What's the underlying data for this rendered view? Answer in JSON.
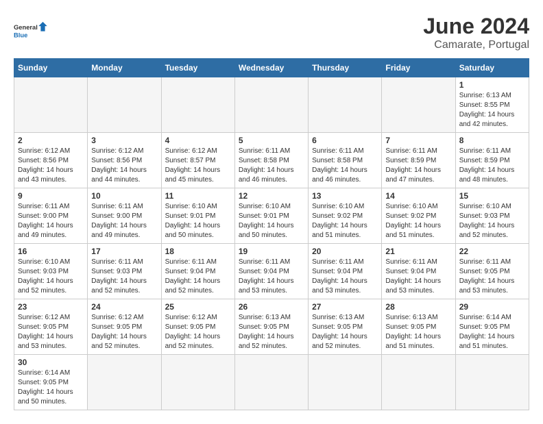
{
  "header": {
    "logo_general": "General",
    "logo_blue": "Blue",
    "month": "June 2024",
    "location": "Camarate, Portugal"
  },
  "days_of_week": [
    "Sunday",
    "Monday",
    "Tuesday",
    "Wednesday",
    "Thursday",
    "Friday",
    "Saturday"
  ],
  "weeks": [
    [
      {
        "day": "",
        "info": ""
      },
      {
        "day": "",
        "info": ""
      },
      {
        "day": "",
        "info": ""
      },
      {
        "day": "",
        "info": ""
      },
      {
        "day": "",
        "info": ""
      },
      {
        "day": "",
        "info": ""
      },
      {
        "day": "1",
        "info": "Sunrise: 6:13 AM\nSunset: 8:55 PM\nDaylight: 14 hours and 42 minutes."
      }
    ],
    [
      {
        "day": "2",
        "info": "Sunrise: 6:12 AM\nSunset: 8:56 PM\nDaylight: 14 hours and 43 minutes."
      },
      {
        "day": "3",
        "info": "Sunrise: 6:12 AM\nSunset: 8:56 PM\nDaylight: 14 hours and 44 minutes."
      },
      {
        "day": "4",
        "info": "Sunrise: 6:12 AM\nSunset: 8:57 PM\nDaylight: 14 hours and 45 minutes."
      },
      {
        "day": "5",
        "info": "Sunrise: 6:11 AM\nSunset: 8:58 PM\nDaylight: 14 hours and 46 minutes."
      },
      {
        "day": "6",
        "info": "Sunrise: 6:11 AM\nSunset: 8:58 PM\nDaylight: 14 hours and 46 minutes."
      },
      {
        "day": "7",
        "info": "Sunrise: 6:11 AM\nSunset: 8:59 PM\nDaylight: 14 hours and 47 minutes."
      },
      {
        "day": "8",
        "info": "Sunrise: 6:11 AM\nSunset: 8:59 PM\nDaylight: 14 hours and 48 minutes."
      }
    ],
    [
      {
        "day": "9",
        "info": "Sunrise: 6:11 AM\nSunset: 9:00 PM\nDaylight: 14 hours and 49 minutes."
      },
      {
        "day": "10",
        "info": "Sunrise: 6:11 AM\nSunset: 9:00 PM\nDaylight: 14 hours and 49 minutes."
      },
      {
        "day": "11",
        "info": "Sunrise: 6:10 AM\nSunset: 9:01 PM\nDaylight: 14 hours and 50 minutes."
      },
      {
        "day": "12",
        "info": "Sunrise: 6:10 AM\nSunset: 9:01 PM\nDaylight: 14 hours and 50 minutes."
      },
      {
        "day": "13",
        "info": "Sunrise: 6:10 AM\nSunset: 9:02 PM\nDaylight: 14 hours and 51 minutes."
      },
      {
        "day": "14",
        "info": "Sunrise: 6:10 AM\nSunset: 9:02 PM\nDaylight: 14 hours and 51 minutes."
      },
      {
        "day": "15",
        "info": "Sunrise: 6:10 AM\nSunset: 9:03 PM\nDaylight: 14 hours and 52 minutes."
      }
    ],
    [
      {
        "day": "16",
        "info": "Sunrise: 6:10 AM\nSunset: 9:03 PM\nDaylight: 14 hours and 52 minutes."
      },
      {
        "day": "17",
        "info": "Sunrise: 6:11 AM\nSunset: 9:03 PM\nDaylight: 14 hours and 52 minutes."
      },
      {
        "day": "18",
        "info": "Sunrise: 6:11 AM\nSunset: 9:04 PM\nDaylight: 14 hours and 52 minutes."
      },
      {
        "day": "19",
        "info": "Sunrise: 6:11 AM\nSunset: 9:04 PM\nDaylight: 14 hours and 53 minutes."
      },
      {
        "day": "20",
        "info": "Sunrise: 6:11 AM\nSunset: 9:04 PM\nDaylight: 14 hours and 53 minutes."
      },
      {
        "day": "21",
        "info": "Sunrise: 6:11 AM\nSunset: 9:04 PM\nDaylight: 14 hours and 53 minutes."
      },
      {
        "day": "22",
        "info": "Sunrise: 6:11 AM\nSunset: 9:05 PM\nDaylight: 14 hours and 53 minutes."
      }
    ],
    [
      {
        "day": "23",
        "info": "Sunrise: 6:12 AM\nSunset: 9:05 PM\nDaylight: 14 hours and 53 minutes."
      },
      {
        "day": "24",
        "info": "Sunrise: 6:12 AM\nSunset: 9:05 PM\nDaylight: 14 hours and 52 minutes."
      },
      {
        "day": "25",
        "info": "Sunrise: 6:12 AM\nSunset: 9:05 PM\nDaylight: 14 hours and 52 minutes."
      },
      {
        "day": "26",
        "info": "Sunrise: 6:13 AM\nSunset: 9:05 PM\nDaylight: 14 hours and 52 minutes."
      },
      {
        "day": "27",
        "info": "Sunrise: 6:13 AM\nSunset: 9:05 PM\nDaylight: 14 hours and 52 minutes."
      },
      {
        "day": "28",
        "info": "Sunrise: 6:13 AM\nSunset: 9:05 PM\nDaylight: 14 hours and 51 minutes."
      },
      {
        "day": "29",
        "info": "Sunrise: 6:14 AM\nSunset: 9:05 PM\nDaylight: 14 hours and 51 minutes."
      }
    ],
    [
      {
        "day": "30",
        "info": "Sunrise: 6:14 AM\nSunset: 9:05 PM\nDaylight: 14 hours and 50 minutes."
      },
      {
        "day": "",
        "info": ""
      },
      {
        "day": "",
        "info": ""
      },
      {
        "day": "",
        "info": ""
      },
      {
        "day": "",
        "info": ""
      },
      {
        "day": "",
        "info": ""
      },
      {
        "day": "",
        "info": ""
      }
    ]
  ]
}
